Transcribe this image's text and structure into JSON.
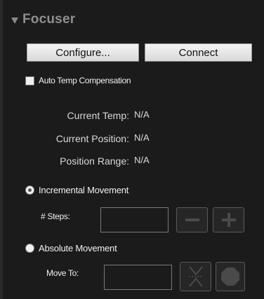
{
  "section": {
    "title": "Focuser",
    "expanded_icon": "triangle-down-icon"
  },
  "buttons": {
    "configure_label": "Configure...",
    "connect_label": "Connect"
  },
  "auto_temp": {
    "label": "Auto Temp Compensation",
    "checked": false
  },
  "info": {
    "current_temp_label": "Current Temp:",
    "current_temp_value": "N/A",
    "current_position_label": "Current Position:",
    "current_position_value": "N/A",
    "position_range_label": "Position Range:",
    "position_range_value": "N/A"
  },
  "incremental": {
    "label": "Incremental Movement",
    "selected": true,
    "steps_label": "# Steps:",
    "steps_value": "",
    "minus_icon": "minus-icon",
    "plus_icon": "plus-icon"
  },
  "absolute": {
    "label": "Absolute Movement",
    "selected": false,
    "move_to_label": "Move To:",
    "move_to_value": "",
    "goto_icon": "move-to-position-icon",
    "stop_icon": "stop-icon"
  }
}
